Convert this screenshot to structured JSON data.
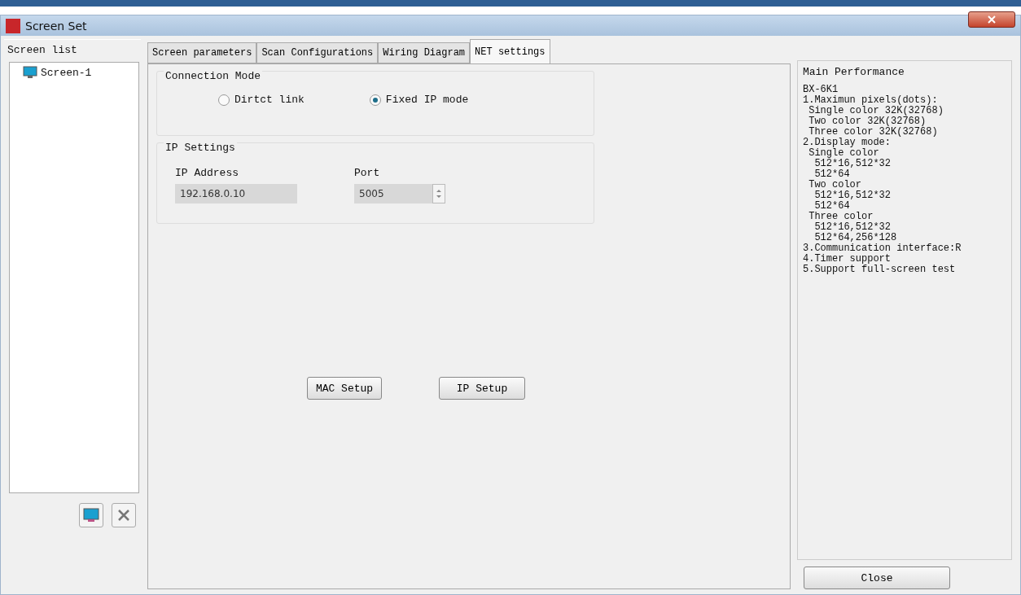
{
  "window": {
    "title": "Screen Set"
  },
  "screen_list": {
    "title": "Screen list",
    "items": [
      {
        "label": "Screen-1",
        "selected": false
      }
    ]
  },
  "tabs": [
    {
      "label": "Screen parameters",
      "selected": false
    },
    {
      "label": "Scan Configurations",
      "selected": false
    },
    {
      "label": "Wiring Diagram",
      "selected": false
    },
    {
      "label": "NET settings",
      "selected": true
    }
  ],
  "connection_mode": {
    "title": "Connection Mode",
    "options": [
      {
        "label": "Dirtct link",
        "selected": false
      },
      {
        "label": "Fixed IP mode",
        "selected": true
      }
    ]
  },
  "ip_settings": {
    "title": "IP Settings",
    "ip_label": "IP Address",
    "ip_value": "192.168.0.10",
    "port_label": "Port",
    "port_value": "5005"
  },
  "buttons": [
    "MAC Setup",
    "IP Setup"
  ],
  "main_performance": {
    "title": "Main Performance",
    "lines": [
      "BX-6K1",
      "1.Maximun pixels(dots):",
      " Single color 32K(32768)",
      " Two color 32K(32768)",
      " Three color 32K(32768)",
      "2.Display mode:",
      " Single color",
      "  512*16,512*32",
      "  512*64",
      " Two color",
      "  512*16,512*32",
      "  512*64",
      " Three color",
      "  512*16,512*32",
      "  512*64,256*128",
      "3.Communication interface:R",
      "4.Timer support",
      "5.Support full-screen test"
    ]
  },
  "close_button": "Close"
}
